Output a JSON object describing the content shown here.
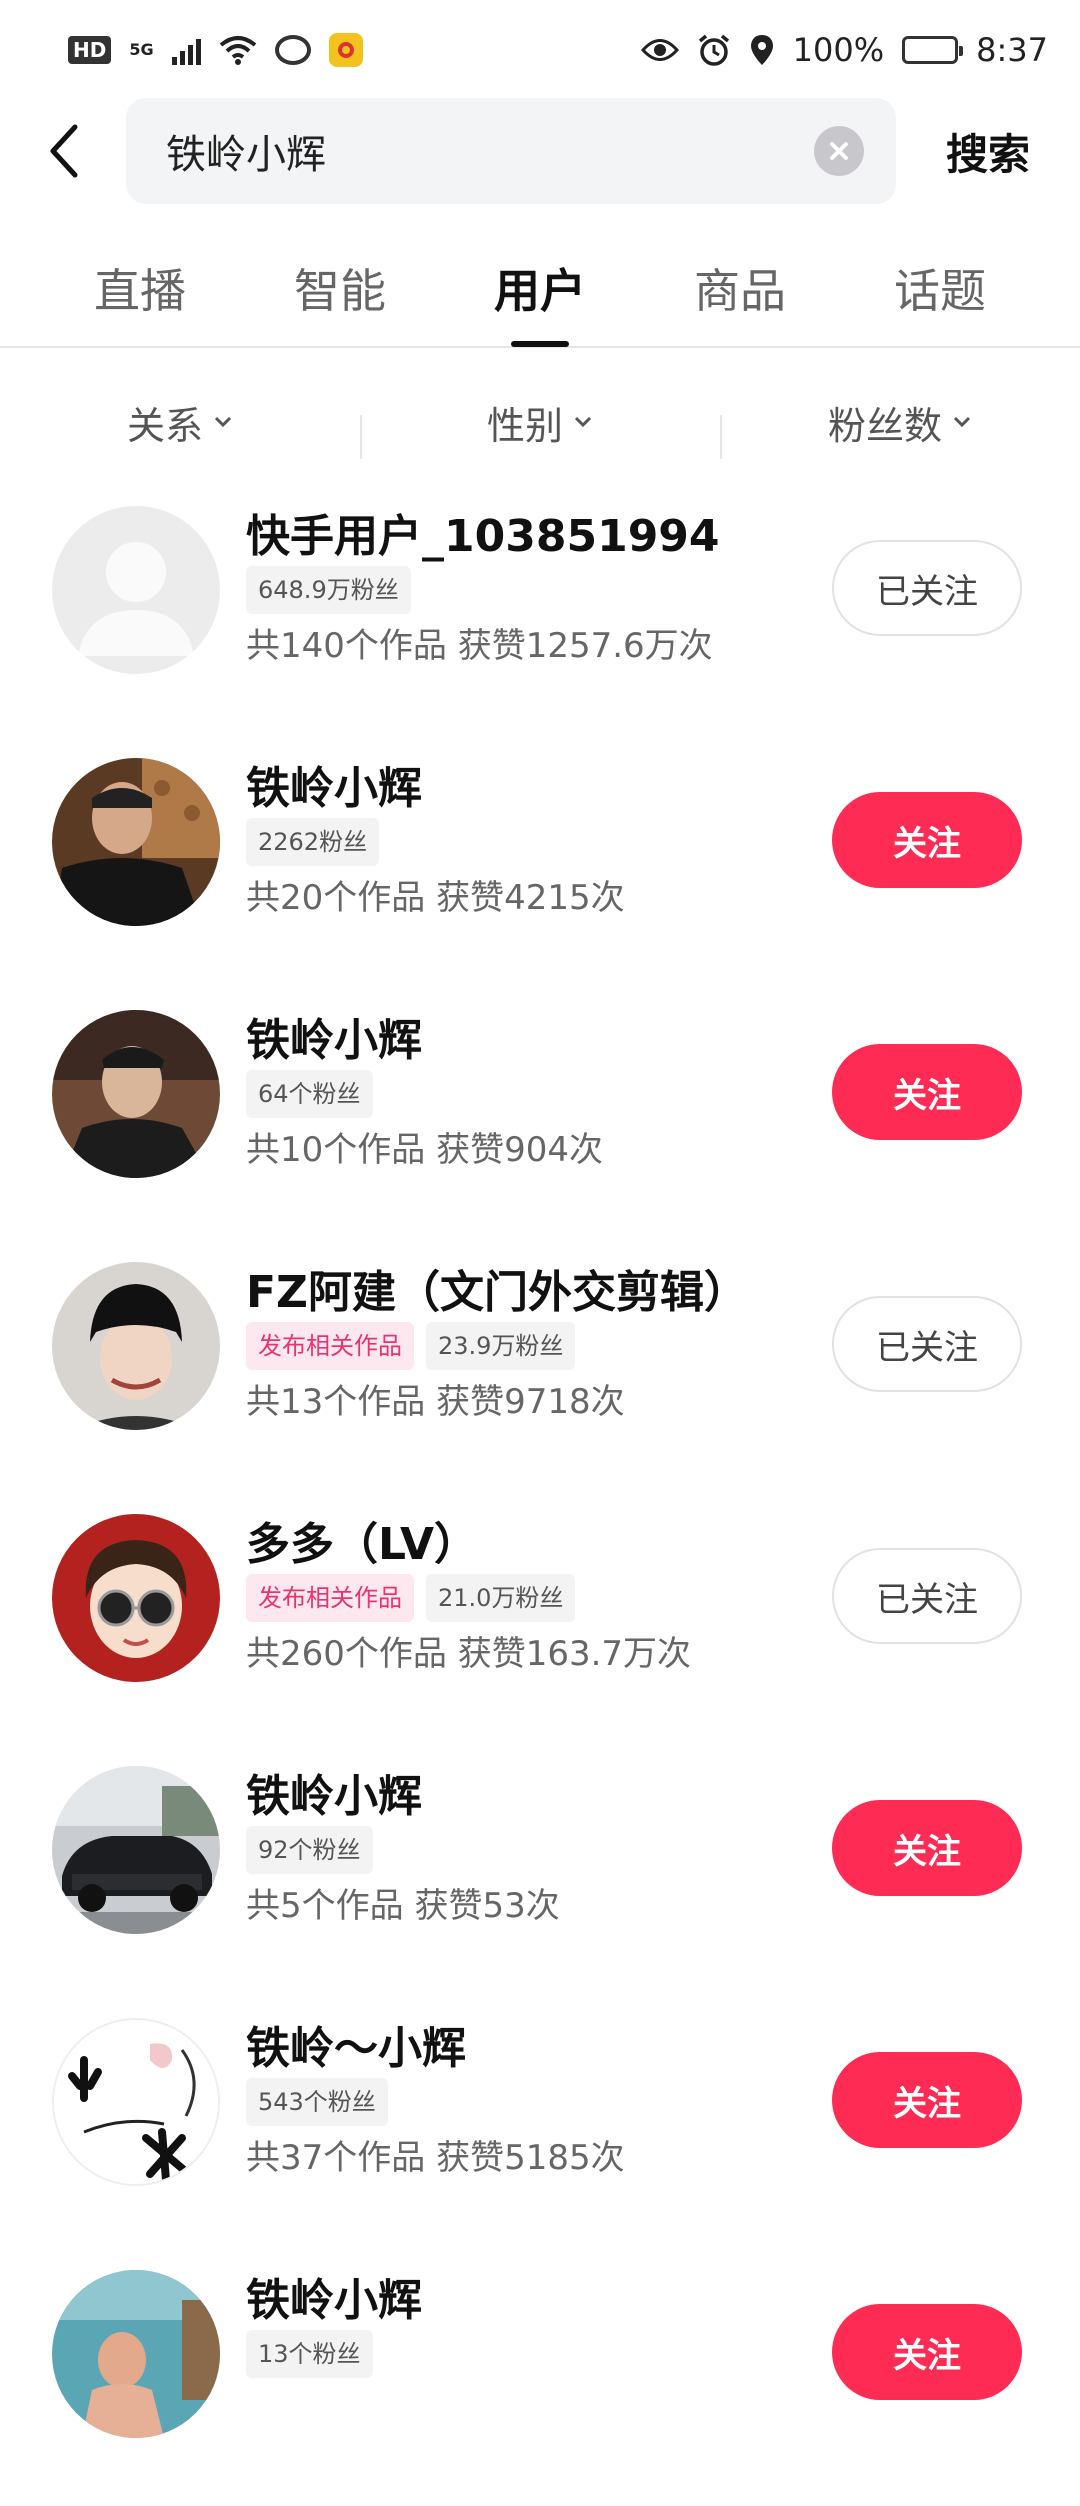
{
  "status_bar": {
    "hd": "HD",
    "network": "5G",
    "battery_pct": "100%",
    "time": "8:37"
  },
  "search": {
    "query": "铁岭小辉",
    "button_label": "搜索"
  },
  "tabs": [
    {
      "label": "直播",
      "active": false
    },
    {
      "label": "智能",
      "active": false
    },
    {
      "label": "用户",
      "active": true
    },
    {
      "label": "商品",
      "active": false
    },
    {
      "label": "话题",
      "active": false
    }
  ],
  "filters": [
    {
      "label": "关系"
    },
    {
      "label": "性别"
    },
    {
      "label": "粉丝数"
    }
  ],
  "users": [
    {
      "name": "快手用户_103851994",
      "tags": [
        {
          "text": "648.9万粉丝",
          "hot": false
        }
      ],
      "stats": "共140个作品 获赞1257.6万次",
      "follow": "已关注",
      "following": true,
      "avatar": "default-avatar"
    },
    {
      "name": "铁岭小辉",
      "tags": [
        {
          "text": "2262粉丝",
          "hot": false
        }
      ],
      "stats": "共20个作品 获赞4215次",
      "follow": "关注",
      "following": false,
      "avatar": "photo-man-dark-room"
    },
    {
      "name": "铁岭小辉",
      "tags": [
        {
          "text": "64个粉丝",
          "hot": false
        }
      ],
      "stats": "共10个作品 获赞904次",
      "follow": "关注",
      "following": false,
      "avatar": "photo-man-black-shirt"
    },
    {
      "name": "FZ阿建（文门外交剪辑）",
      "tags": [
        {
          "text": "发布相关作品",
          "hot": true
        },
        {
          "text": "23.9万粉丝",
          "hot": false
        }
      ],
      "stats": "共13个作品 获赞9718次",
      "follow": "已关注",
      "following": true,
      "avatar": "photo-man-black-beanie"
    },
    {
      "name": "多多（LV）",
      "tags": [
        {
          "text": "发布相关作品",
          "hot": true
        },
        {
          "text": "21.0万粉丝",
          "hot": false
        }
      ],
      "stats": "共260个作品 获赞163.7万次",
      "follow": "已关注",
      "following": true,
      "avatar": "cartoon-sunglasses"
    },
    {
      "name": "铁岭小辉",
      "tags": [
        {
          "text": "92个粉丝",
          "hot": false
        }
      ],
      "stats": "共5个作品 获赞53次",
      "follow": "关注",
      "following": false,
      "avatar": "photo-black-car"
    },
    {
      "name": "铁岭～小辉",
      "tags": [
        {
          "text": "543个粉丝",
          "hot": false
        }
      ],
      "stats": "共37个作品 获赞5185次",
      "follow": "关注",
      "following": false,
      "avatar": "calligraphy-text"
    },
    {
      "name": "铁岭小辉",
      "tags": [
        {
          "text": "13个粉丝",
          "hot": false
        }
      ],
      "stats": "",
      "follow": "关注",
      "following": false,
      "avatar": "photo-man-seaside"
    }
  ],
  "colors": {
    "accent": "#fe2c55",
    "hot_tag": "#e8336d"
  }
}
